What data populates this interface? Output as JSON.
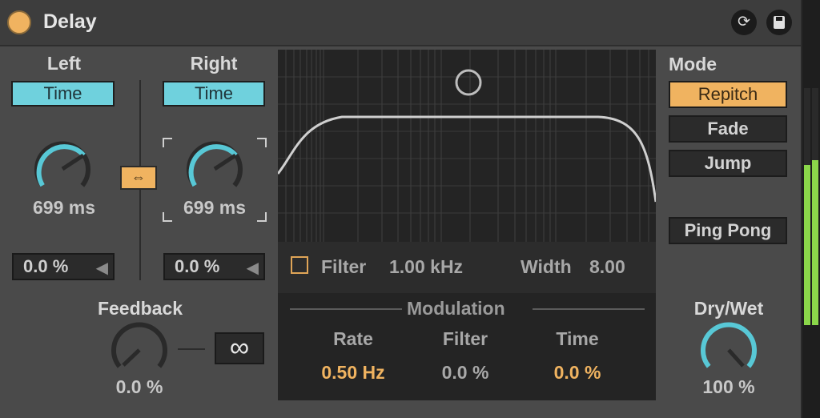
{
  "header": {
    "title": "Delay",
    "hot_swap_icon": "hot-swap-icon",
    "save_icon": "save-icon"
  },
  "left": {
    "label": "Left",
    "mode_label": "Time",
    "time_value": "699 ms",
    "offset_value": "0.0 %"
  },
  "right": {
    "label": "Right",
    "mode_label": "Time",
    "time_value": "699 ms",
    "offset_value": "0.0 %"
  },
  "feedback": {
    "label": "Feedback",
    "value": "0.0 %",
    "freeze_glyph": "∞"
  },
  "filter": {
    "label": "Filter",
    "frequency": "1.00 kHz",
    "width_label": "Width",
    "width_value": "8.00"
  },
  "modulation": {
    "title": "Modulation",
    "rate_label": "Rate",
    "rate_value": "0.50 Hz",
    "filter_label": "Filter",
    "filter_value": "0.0 %",
    "time_label": "Time",
    "time_value": "0.0 %"
  },
  "mode": {
    "label": "Mode",
    "options": [
      "Repitch",
      "Fade",
      "Jump"
    ],
    "selected": "Repitch",
    "ping_pong_label": "Ping Pong"
  },
  "dry_wet": {
    "label": "Dry/Wet",
    "value": "100 %"
  },
  "colors": {
    "accent_orange": "#f0b360",
    "time_button": "#6fd1dd",
    "knob_arc": "#58c8d6",
    "meter_green": "#8bd74a"
  }
}
